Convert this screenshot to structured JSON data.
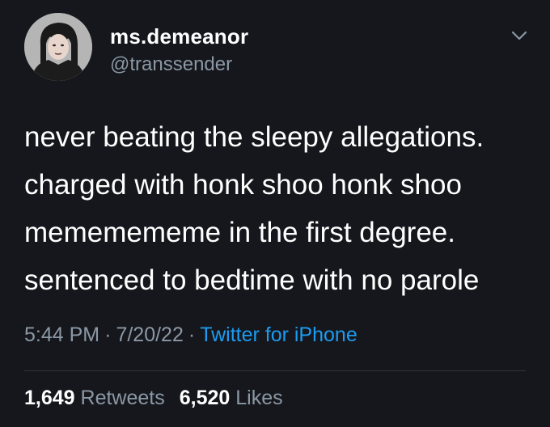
{
  "author": {
    "display_name": "ms.demeanor",
    "handle": "@transsender",
    "avatar_icon": "user-avatar"
  },
  "menu_icon": "chevron-down-icon",
  "tweet": {
    "lines": [
      "never beating the sleepy allegations.",
      "charged with honk shoo honk shoo",
      "mememememe in the first degree.",
      "sentenced to bedtime with no parole"
    ]
  },
  "meta": {
    "time": "5:44 PM",
    "separator": "·",
    "date": "7/20/22",
    "source": "Twitter for iPhone"
  },
  "stats": {
    "retweets_count": "1,649",
    "retweets_label": "Retweets",
    "likes_count": "6,520",
    "likes_label": "Likes"
  },
  "colors": {
    "background": "#15171c",
    "text": "#ffffff",
    "secondary": "#8b98a5",
    "link": "#1d9bf0"
  }
}
